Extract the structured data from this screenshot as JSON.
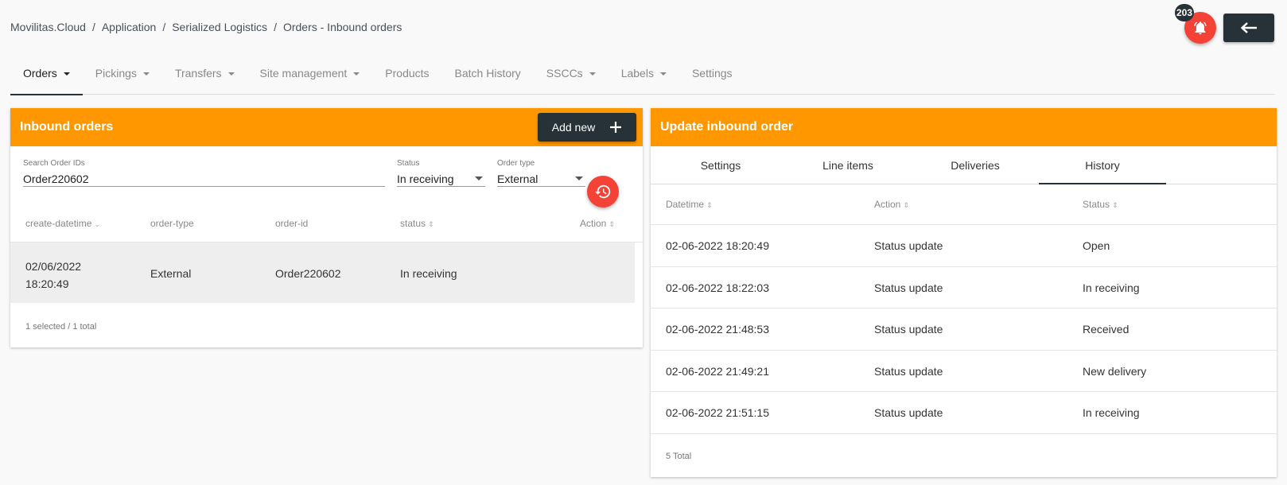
{
  "breadcrumb": [
    "Movilitas.Cloud",
    "Application",
    "Serialized Logistics",
    "Orders - Inbound orders"
  ],
  "breadcrumb_separator": "/",
  "notifications": {
    "count": "203",
    "icon": "bell-icon"
  },
  "back_button": {
    "icon": "arrow-left-icon"
  },
  "nav": [
    {
      "label": "Orders",
      "dropdown": true,
      "active": true
    },
    {
      "label": "Pickings",
      "dropdown": true
    },
    {
      "label": "Transfers",
      "dropdown": true
    },
    {
      "label": "Site management",
      "dropdown": true
    },
    {
      "label": "Products",
      "dropdown": false
    },
    {
      "label": "Batch History",
      "dropdown": false
    },
    {
      "label": "SSCCs",
      "dropdown": true
    },
    {
      "label": "Labels",
      "dropdown": true
    },
    {
      "label": "Settings",
      "dropdown": false
    }
  ],
  "left_panel": {
    "title": "Inbound orders",
    "add_label": "Add new",
    "search": {
      "label": "Search Order IDs",
      "value": "Order220602"
    },
    "status": {
      "label": "Status",
      "value": "In receiving"
    },
    "order_type": {
      "label": "Order type",
      "value": "External"
    },
    "columns": [
      "create-datetime",
      "order-type",
      "order-id",
      "status",
      "Action"
    ],
    "rows": [
      {
        "date": "02/06/2022",
        "time": "18:20:49",
        "order_type": "External",
        "order_id": "Order220602",
        "status": "In receiving"
      }
    ],
    "footer": "1 selected / 1 total"
  },
  "right_panel": {
    "title": "Update inbound order",
    "tabs": [
      "Settings",
      "Line items",
      "Deliveries",
      "History"
    ],
    "active_tab": "History",
    "columns": [
      "Datetime",
      "Action",
      "Status"
    ],
    "rows": [
      {
        "datetime": "02-06-2022 18:20:49",
        "action": "Status update",
        "status": "Open"
      },
      {
        "datetime": "02-06-2022 18:22:03",
        "action": "Status update",
        "status": "In receiving"
      },
      {
        "datetime": "02-06-2022 21:48:53",
        "action": "Status update",
        "status": "Received"
      },
      {
        "datetime": "02-06-2022 21:49:21",
        "action": "Status update",
        "status": "New delivery"
      },
      {
        "datetime": "02-06-2022 21:51:15",
        "action": "Status update",
        "status": "In receiving"
      }
    ],
    "footer": "5 Total"
  },
  "colors": {
    "accent": "#ff9800",
    "dark": "#263238",
    "danger": "#f44336"
  }
}
